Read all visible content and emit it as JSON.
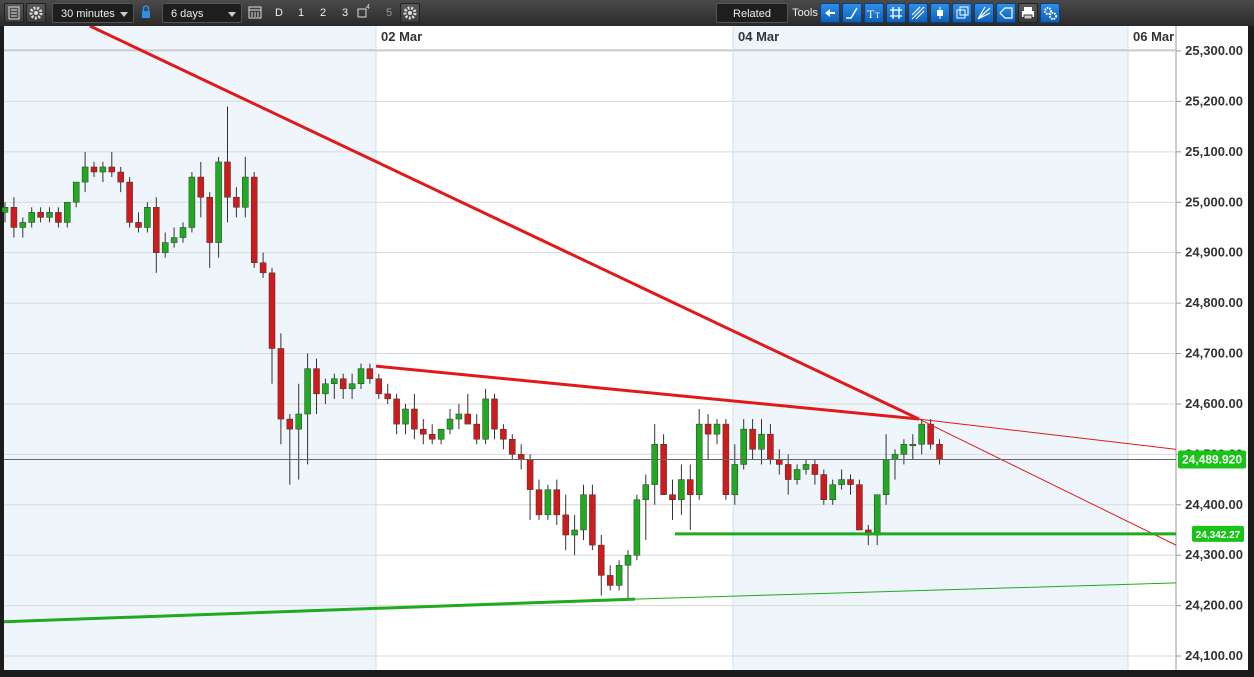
{
  "toolbar": {
    "interval_value": "30 minutes",
    "range_value": "6 days",
    "period_buttons": [
      "D",
      "1",
      "2",
      "3",
      "4",
      "5"
    ],
    "related_label": "Related",
    "tools_label": "Tools",
    "icons": [
      "menu-icon",
      "settings-icon",
      "lock-icon",
      "calendar-icon",
      "settings-icon",
      "arrow-left-icon",
      "line-tool-icon",
      "text-tool-icon",
      "grid-icon",
      "fib-tool-icon",
      "candle-icon",
      "copy-icon",
      "fan-icon",
      "shape-icon",
      "print-icon",
      "tools-settings-icon"
    ]
  },
  "chart_data": {
    "type": "candlestick",
    "x_labels": [
      "02 Mar",
      "04 Mar",
      "06 Mar"
    ],
    "y_ticks": [
      "25,300.00",
      "25,200.00",
      "25,100.00",
      "25,000.00",
      "24,900.00",
      "24,800.00",
      "24,700.00",
      "24,600.00",
      "24,500.00",
      "24,400.00",
      "24,300.00",
      "24,200.00",
      "24,100.00"
    ],
    "ylim": [
      24080,
      25310
    ],
    "current_price": "24,489.920",
    "marker_price": "24,342.27",
    "candles": [
      [
        24980,
        25000,
        24960,
        24990
      ],
      [
        24990,
        25010,
        24930,
        24950
      ],
      [
        24950,
        24970,
        24930,
        24960
      ],
      [
        24960,
        24990,
        24950,
        24980
      ],
      [
        24980,
        24990,
        24960,
        24970
      ],
      [
        24970,
        24990,
        24960,
        24980
      ],
      [
        24980,
        24990,
        24950,
        24960
      ],
      [
        24960,
        25000,
        24950,
        25000
      ],
      [
        25000,
        25040,
        24990,
        25040
      ],
      [
        25040,
        25100,
        25020,
        25070
      ],
      [
        25070,
        25080,
        25050,
        25060
      ],
      [
        25060,
        25080,
        25040,
        25070
      ],
      [
        25070,
        25100,
        25050,
        25060
      ],
      [
        25060,
        25070,
        25020,
        25040
      ],
      [
        25040,
        25050,
        24950,
        24960
      ],
      [
        24960,
        24980,
        24940,
        24950
      ],
      [
        24950,
        25000,
        24940,
        24990
      ],
      [
        24990,
        25010,
        24860,
        24900
      ],
      [
        24900,
        24940,
        24890,
        24920
      ],
      [
        24920,
        24950,
        24910,
        24930
      ],
      [
        24930,
        24960,
        24920,
        24950
      ],
      [
        24950,
        25060,
        24940,
        25050
      ],
      [
        25050,
        25080,
        24970,
        25010
      ],
      [
        25010,
        25020,
        24870,
        24920
      ],
      [
        24920,
        25090,
        24890,
        25080
      ],
      [
        25080,
        25190,
        24960,
        25010
      ],
      [
        25010,
        25030,
        24970,
        24990
      ],
      [
        24990,
        25090,
        24970,
        25050
      ],
      [
        25050,
        25060,
        24870,
        24880
      ],
      [
        24880,
        24900,
        24850,
        24860
      ],
      [
        24860,
        24870,
        24640,
        24710
      ],
      [
        24710,
        24740,
        24520,
        24570
      ],
      [
        24570,
        24580,
        24440,
        24550
      ],
      [
        24550,
        24640,
        24450,
        24580
      ],
      [
        24580,
        24700,
        24480,
        24670
      ],
      [
        24670,
        24690,
        24580,
        24620
      ],
      [
        24620,
        24650,
        24600,
        24640
      ],
      [
        24640,
        24660,
        24610,
        24650
      ],
      [
        24650,
        24660,
        24610,
        24630
      ],
      [
        24630,
        24660,
        24610,
        24640
      ],
      [
        24640,
        24680,
        24630,
        24670
      ],
      [
        24670,
        24680,
        24640,
        24650
      ],
      [
        24650,
        24660,
        24610,
        24620
      ],
      [
        24620,
        24640,
        24600,
        24610
      ],
      [
        24610,
        24620,
        24540,
        24560
      ],
      [
        24560,
        24600,
        24540,
        24590
      ],
      [
        24590,
        24620,
        24530,
        24550
      ],
      [
        24550,
        24570,
        24520,
        24540
      ],
      [
        24540,
        24560,
        24520,
        24530
      ],
      [
        24530,
        24550,
        24520,
        24550
      ],
      [
        24550,
        24590,
        24540,
        24570
      ],
      [
        24570,
        24600,
        24550,
        24580
      ],
      [
        24580,
        24620,
        24560,
        24560
      ],
      [
        24560,
        24580,
        24520,
        24530
      ],
      [
        24530,
        24630,
        24520,
        24610
      ],
      [
        24610,
        24620,
        24530,
        24550
      ],
      [
        24550,
        24560,
        24510,
        24530
      ],
      [
        24530,
        24540,
        24490,
        24500
      ],
      [
        24500,
        24520,
        24470,
        24490
      ],
      [
        24490,
        24500,
        24370,
        24430
      ],
      [
        24430,
        24450,
        24370,
        24380
      ],
      [
        24380,
        24440,
        24370,
        24430
      ],
      [
        24430,
        24450,
        24360,
        24380
      ],
      [
        24380,
        24420,
        24310,
        24340
      ],
      [
        24340,
        24380,
        24300,
        24350
      ],
      [
        24350,
        24440,
        24330,
        24420
      ],
      [
        24420,
        24440,
        24310,
        24320
      ],
      [
        24320,
        24340,
        24220,
        24260
      ],
      [
        24260,
        24280,
        24230,
        24240
      ],
      [
        24240,
        24290,
        24230,
        24280
      ],
      [
        24280,
        24310,
        24210,
        24300
      ],
      [
        24300,
        24420,
        24290,
        24410
      ],
      [
        24410,
        24460,
        24330,
        24440
      ],
      [
        24440,
        24560,
        24400,
        24520
      ],
      [
        24520,
        24540,
        24420,
        24420
      ],
      [
        24420,
        24450,
        24370,
        24410
      ],
      [
        24410,
        24480,
        24380,
        24450
      ],
      [
        24450,
        24480,
        24350,
        24420
      ],
      [
        24420,
        24590,
        24410,
        24560
      ],
      [
        24560,
        24580,
        24490,
        24540
      ],
      [
        24540,
        24570,
        24520,
        24560
      ],
      [
        24560,
        24570,
        24410,
        24420
      ],
      [
        24420,
        24520,
        24400,
        24480
      ],
      [
        24480,
        24570,
        24470,
        24550
      ],
      [
        24550,
        24570,
        24490,
        24510
      ],
      [
        24510,
        24570,
        24480,
        24540
      ],
      [
        24540,
        24560,
        24480,
        24490
      ],
      [
        24490,
        24510,
        24460,
        24480
      ],
      [
        24480,
        24500,
        24420,
        24450
      ],
      [
        24450,
        24480,
        24440,
        24470
      ],
      [
        24470,
        24490,
        24460,
        24480
      ],
      [
        24480,
        24490,
        24440,
        24460
      ],
      [
        24460,
        24470,
        24400,
        24410
      ],
      [
        24410,
        24450,
        24400,
        24440
      ],
      [
        24440,
        24470,
        24430,
        24450
      ],
      [
        24450,
        24460,
        24420,
        24440
      ],
      [
        24440,
        24450,
        24360,
        24350
      ],
      [
        24350,
        24360,
        24320,
        24340
      ],
      [
        24340,
        24420,
        24320,
        24420
      ],
      [
        24420,
        24540,
        24400,
        24490
      ],
      [
        24490,
        24510,
        24450,
        24500
      ],
      [
        24500,
        24530,
        24480,
        24520
      ],
      [
        24520,
        24540,
        24490,
        24520
      ],
      [
        24520,
        24570,
        24500,
        24560
      ],
      [
        24560,
        24570,
        24510,
        24520
      ],
      [
        24520,
        24530,
        24480,
        24490
      ]
    ]
  },
  "drawings": {
    "red_line_main": [
      24700,
      24570,
      24500
    ],
    "red_line_thin": 24510
  }
}
